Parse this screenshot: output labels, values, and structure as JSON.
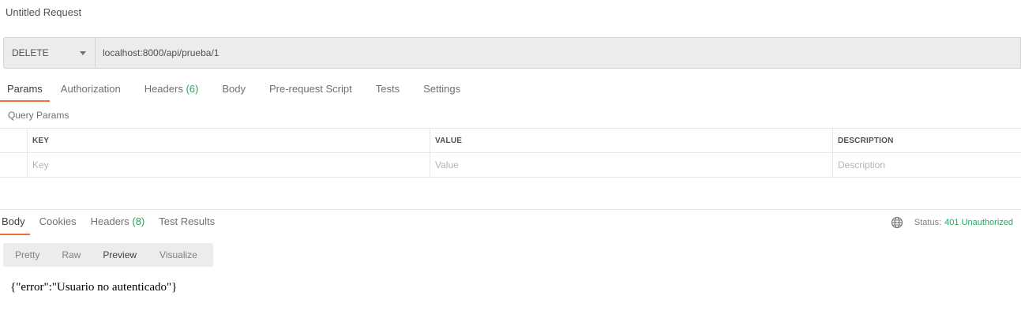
{
  "request": {
    "title": "Untitled Request",
    "method": "DELETE",
    "url": "localhost:8000/api/prueba/1"
  },
  "request_tabs": [
    {
      "label": "Params",
      "count": "",
      "active": true
    },
    {
      "label": "Authorization",
      "count": "",
      "active": false
    },
    {
      "label": "Headers",
      "count": "(6)",
      "active": false
    },
    {
      "label": "Body",
      "count": "",
      "active": false
    },
    {
      "label": "Pre-request Script",
      "count": "",
      "active": false
    },
    {
      "label": "Tests",
      "count": "",
      "active": false
    },
    {
      "label": "Settings",
      "count": "",
      "active": false
    }
  ],
  "query_params": {
    "title": "Query Params",
    "headers": {
      "key": "KEY",
      "value": "VALUE",
      "description": "DESCRIPTION"
    },
    "placeholders": {
      "key": "Key",
      "value": "Value",
      "description": "Description"
    }
  },
  "response_tabs": [
    {
      "label": "Body",
      "count": "",
      "active": true
    },
    {
      "label": "Cookies",
      "count": "",
      "active": false
    },
    {
      "label": "Headers",
      "count": "(8)",
      "active": false
    },
    {
      "label": "Test Results",
      "count": "",
      "active": false
    }
  ],
  "status": {
    "label": "Status:",
    "value": "401 Unauthorized",
    "icon": "globe-icon"
  },
  "view_tabs": [
    {
      "label": "Pretty",
      "active": false
    },
    {
      "label": "Raw",
      "active": false
    },
    {
      "label": "Preview",
      "active": true
    },
    {
      "label": "Visualize",
      "active": false
    }
  ],
  "response_body": "{\"error\":\"Usuario no autenticado\"}",
  "colors": {
    "accent": "#f26b3a",
    "success": "#26a65b"
  }
}
